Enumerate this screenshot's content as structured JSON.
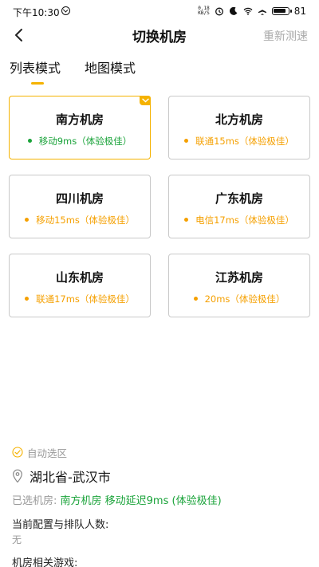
{
  "status_bar": {
    "time": "下午10:30",
    "net_speed_value": "0.18",
    "net_speed_unit": "KB/S",
    "battery_level": "81"
  },
  "nav": {
    "title": "切换机房",
    "retest_label": "重新测速"
  },
  "tabs": [
    {
      "label": "列表模式",
      "active": true
    },
    {
      "label": "地图模式",
      "active": false
    }
  ],
  "servers": [
    {
      "name": "南方机房",
      "latency": "移动9ms（体验极佳）",
      "selected": true
    },
    {
      "name": "北方机房",
      "latency": "联通15ms（体验极佳）",
      "selected": false
    },
    {
      "name": "四川机房",
      "latency": "移动15ms（体验极佳）",
      "selected": false
    },
    {
      "name": "广东机房",
      "latency": "电信17ms（体验极佳）",
      "selected": false
    },
    {
      "name": "山东机房",
      "latency": "联通17ms（体验极佳）",
      "selected": false
    },
    {
      "name": "江苏机房",
      "latency": "20ms（体验极佳）",
      "selected": false
    }
  ],
  "bottom": {
    "auto_select_label": "自动选区",
    "location": "湖北省-武汉市",
    "selected_label": "已选机房:",
    "selected_value": "南方机房 移动延迟9ms (体验极佳)",
    "config_label": "当前配置与排队人数:",
    "config_value": "无",
    "games_label": "机房相关游戏:"
  },
  "colors": {
    "accent": "#f5b200",
    "good": "#1aa33a",
    "latency": "#f5a000",
    "muted": "#999999"
  },
  "icons": {
    "back": "chevron-left-icon",
    "check": "check-icon",
    "location": "location-pin-icon",
    "auto_select": "check-circle-icon"
  }
}
